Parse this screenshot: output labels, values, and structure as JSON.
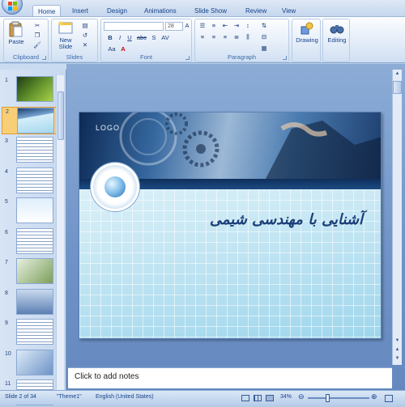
{
  "ribbon_tabs": [
    "Home",
    "Insert",
    "Design",
    "Animations",
    "Slide Show",
    "Review",
    "View"
  ],
  "ribbon": {
    "groups": {
      "clipboard": "Clipboard",
      "slides": "Slides",
      "font": "Font",
      "paragraph": "Paragraph"
    },
    "paste_label": "Paste",
    "new_slide_label": "New Slide",
    "font_size_value": "28",
    "drawing_label": "Drawing",
    "editing_label": "Editing",
    "font_buttons": [
      "B",
      "I",
      "U",
      "abc",
      "S",
      "AV",
      "Aa",
      "A"
    ],
    "grow_shrink": [
      "A",
      "A"
    ]
  },
  "thumbnails": [
    {
      "num": "1"
    },
    {
      "num": "2"
    },
    {
      "num": "3"
    },
    {
      "num": "4"
    },
    {
      "num": "5"
    },
    {
      "num": "6"
    },
    {
      "num": "7"
    },
    {
      "num": "8"
    },
    {
      "num": "9"
    },
    {
      "num": "10"
    },
    {
      "num": "11"
    }
  ],
  "selected_slide_index": 1,
  "slide": {
    "logo_text": "LOGO",
    "title": "آشنایی با مهندسی شیمی"
  },
  "notes_placeholder": "Click to add notes",
  "status": {
    "slide_info": "Slide 2 of 34",
    "theme": "\"Theme1\"",
    "language": "English (United States)",
    "zoom": "34%"
  },
  "colors": {
    "ribbon_text": "#15428b",
    "selected_thumb": "#f8cf76",
    "title_color": "#1c3f7a"
  }
}
